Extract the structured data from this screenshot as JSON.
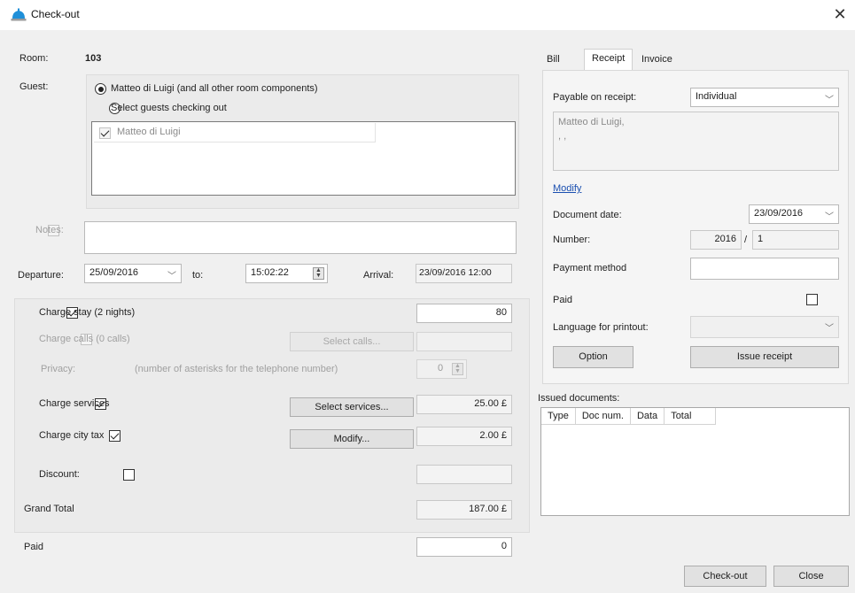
{
  "window": {
    "title": "Check-out"
  },
  "room": {
    "label": "Room:",
    "value": "103"
  },
  "guest": {
    "label": "Guest:",
    "option_all": "Matteo di Luigi (and all other room components)",
    "option_select": "Select guests checking out",
    "list": [
      {
        "name": "Matteo di Luigi",
        "checked": true
      }
    ]
  },
  "notes": {
    "label": "Notes:",
    "value": ""
  },
  "departure": {
    "label": "Departure:",
    "date": "25/09/2016",
    "to_label": "to:",
    "time": "15:02:22",
    "arrival_label": "Arrival:",
    "arrival": "23/09/2016 12:00"
  },
  "charges": {
    "stay": {
      "label": "Charge stay (2 nights)",
      "checked": true,
      "value": "80"
    },
    "calls": {
      "label": "Charge calls (0 calls)",
      "checked": false,
      "button": "Select calls...",
      "value": ""
    },
    "privacy": {
      "label": "Privacy:",
      "hint": "(number of asterisks for the telephone number)",
      "value": "0"
    },
    "services": {
      "label": "Charge services",
      "checked": true,
      "button": "Select services...",
      "value": "25.00 £"
    },
    "city_tax": {
      "label": "Charge city tax",
      "checked": true,
      "button": "Modify...",
      "value": "2.00 £"
    },
    "discount": {
      "label": "Discount:",
      "checked": false,
      "value": ""
    },
    "grand_total": {
      "label": "Grand Total",
      "value": "187.00 £"
    }
  },
  "paid": {
    "label": "Paid",
    "value": "0"
  },
  "tabs": [
    {
      "label": "Bill"
    },
    {
      "label": "Receipt"
    },
    {
      "label": "Invoice"
    }
  ],
  "receipt": {
    "payable_label": "Payable on receipt:",
    "payable_value": "Individual",
    "payee_line1": "Matteo di Luigi,",
    "payee_line2": ", ,",
    "modify_link": "Modify",
    "doc_date_label": "Document date:",
    "doc_date": "23/09/2016",
    "number_label": "Number:",
    "number_year": "2016",
    "number_sep": "/",
    "number_value": "1",
    "payment_label": "Payment method",
    "payment_value": "",
    "paid_label": "Paid",
    "language_label": "Language for printout:",
    "language_value": "",
    "option_button": "Option",
    "issue_button": "Issue receipt"
  },
  "issued": {
    "label": "Issued documents:",
    "columns": [
      "Type",
      "Doc num.",
      "Data",
      "Total"
    ]
  },
  "footer": {
    "checkout_button": "Check-out",
    "close_button": "Close"
  },
  "colors": {
    "accent": "#1a4fb0",
    "bell": "#1f8fd8"
  }
}
